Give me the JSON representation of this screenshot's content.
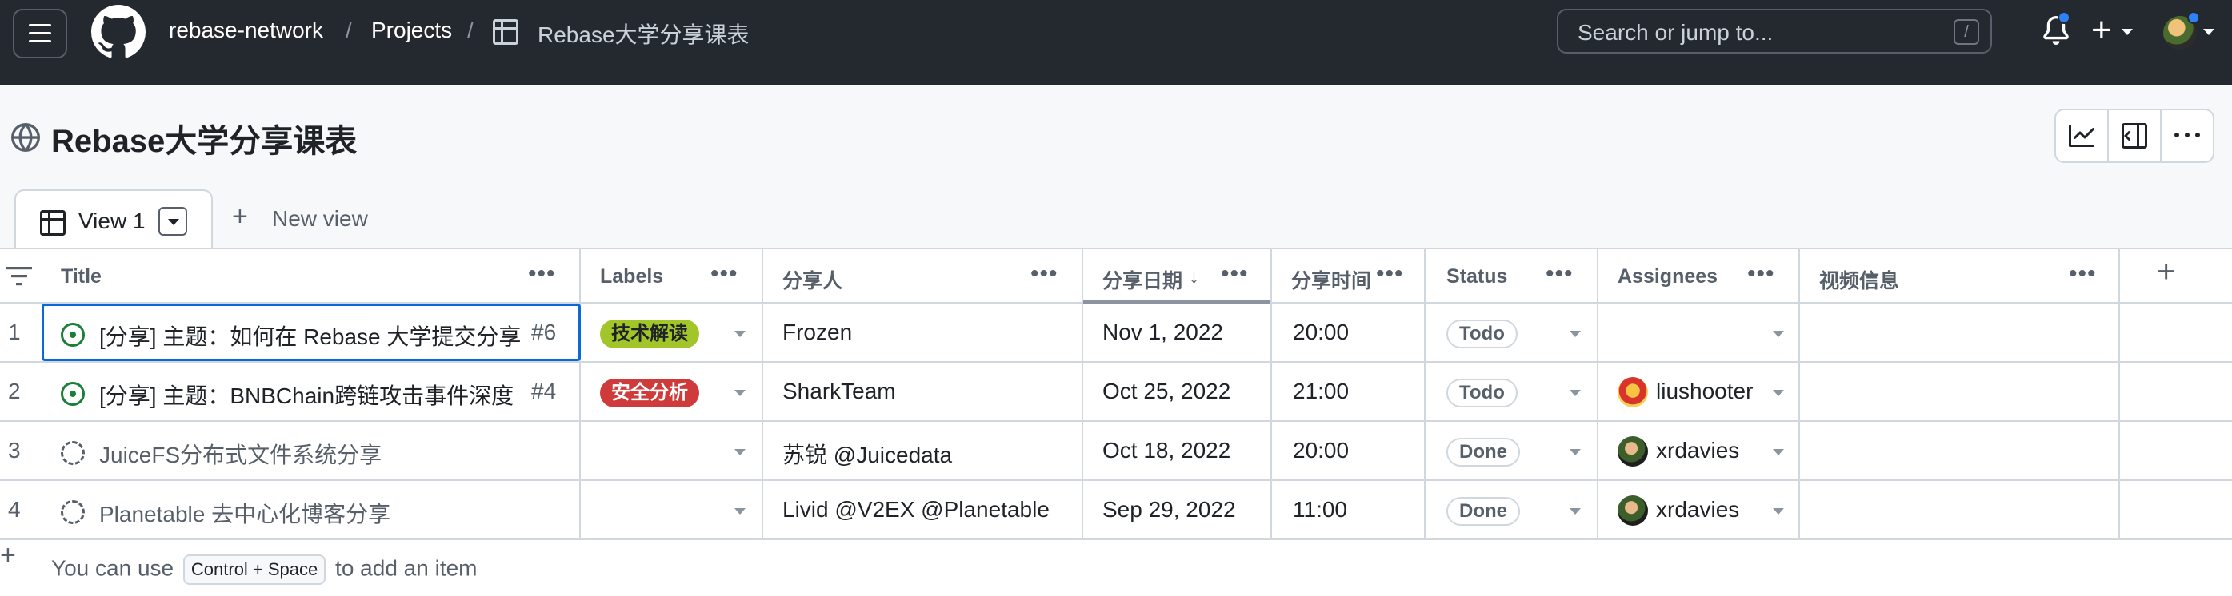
{
  "topbar": {
    "breadcrumb": [
      "rebase-network",
      "Projects",
      "Rebase大学分享课表"
    ],
    "search_placeholder": "Search or jump to...",
    "search_shortcut": "/",
    "plus_label": "+"
  },
  "header": {
    "title": "Rebase大学分享课表",
    "views": [
      {
        "label": "View 1"
      }
    ],
    "new_view_label": "New view"
  },
  "table": {
    "columns": [
      "Title",
      "Labels",
      "分享人",
      "分享日期",
      "分享时间",
      "Status",
      "Assignees",
      "视频信息"
    ],
    "sorted_column": "分享日期",
    "sort_direction": "descending",
    "rows": [
      {
        "num": "1",
        "state": "open",
        "title": "[分享] 主题：如何在 Rebase 大学提交分享",
        "issue": "#6",
        "label": "技术解读",
        "label_color": "#a2c62a",
        "label_text_color": "#1f2328",
        "speaker": "Frozen",
        "date": "Nov 1, 2022",
        "time": "20:00",
        "status": "Todo",
        "assignee": ""
      },
      {
        "num": "2",
        "state": "open",
        "title": "[分享] 主题：BNBChain跨链攻击事件深度",
        "issue": "#4",
        "label": "安全分析",
        "label_color": "#cf3a3a",
        "label_text_color": "#ffffff",
        "speaker": "SharkTeam",
        "date": "Oct 25, 2022",
        "time": "21:00",
        "status": "Todo",
        "assignee": "liushooter"
      },
      {
        "num": "3",
        "state": "draft",
        "title": "JuiceFS分布式文件系统分享",
        "issue": "",
        "label": "",
        "speaker": "苏锐 @Juicedata",
        "date": "Oct 18, 2022",
        "time": "20:00",
        "status": "Done",
        "assignee": "xrdavies"
      },
      {
        "num": "4",
        "state": "draft",
        "title": "Planetable 去中心化博客分享",
        "issue": "",
        "label": "",
        "speaker": "Livid @V2EX @Planetable",
        "date": "Sep 29, 2022",
        "time": "11:00",
        "status": "Done",
        "assignee": "xrdavies"
      }
    ]
  },
  "footer": {
    "prefix": "You can use",
    "shortcut": "Control + Space",
    "suffix": "to add an item"
  },
  "colors": {
    "topbar_bg": "#24292f",
    "accent_blue": "#0969da",
    "open_green": "#1a7f37"
  }
}
